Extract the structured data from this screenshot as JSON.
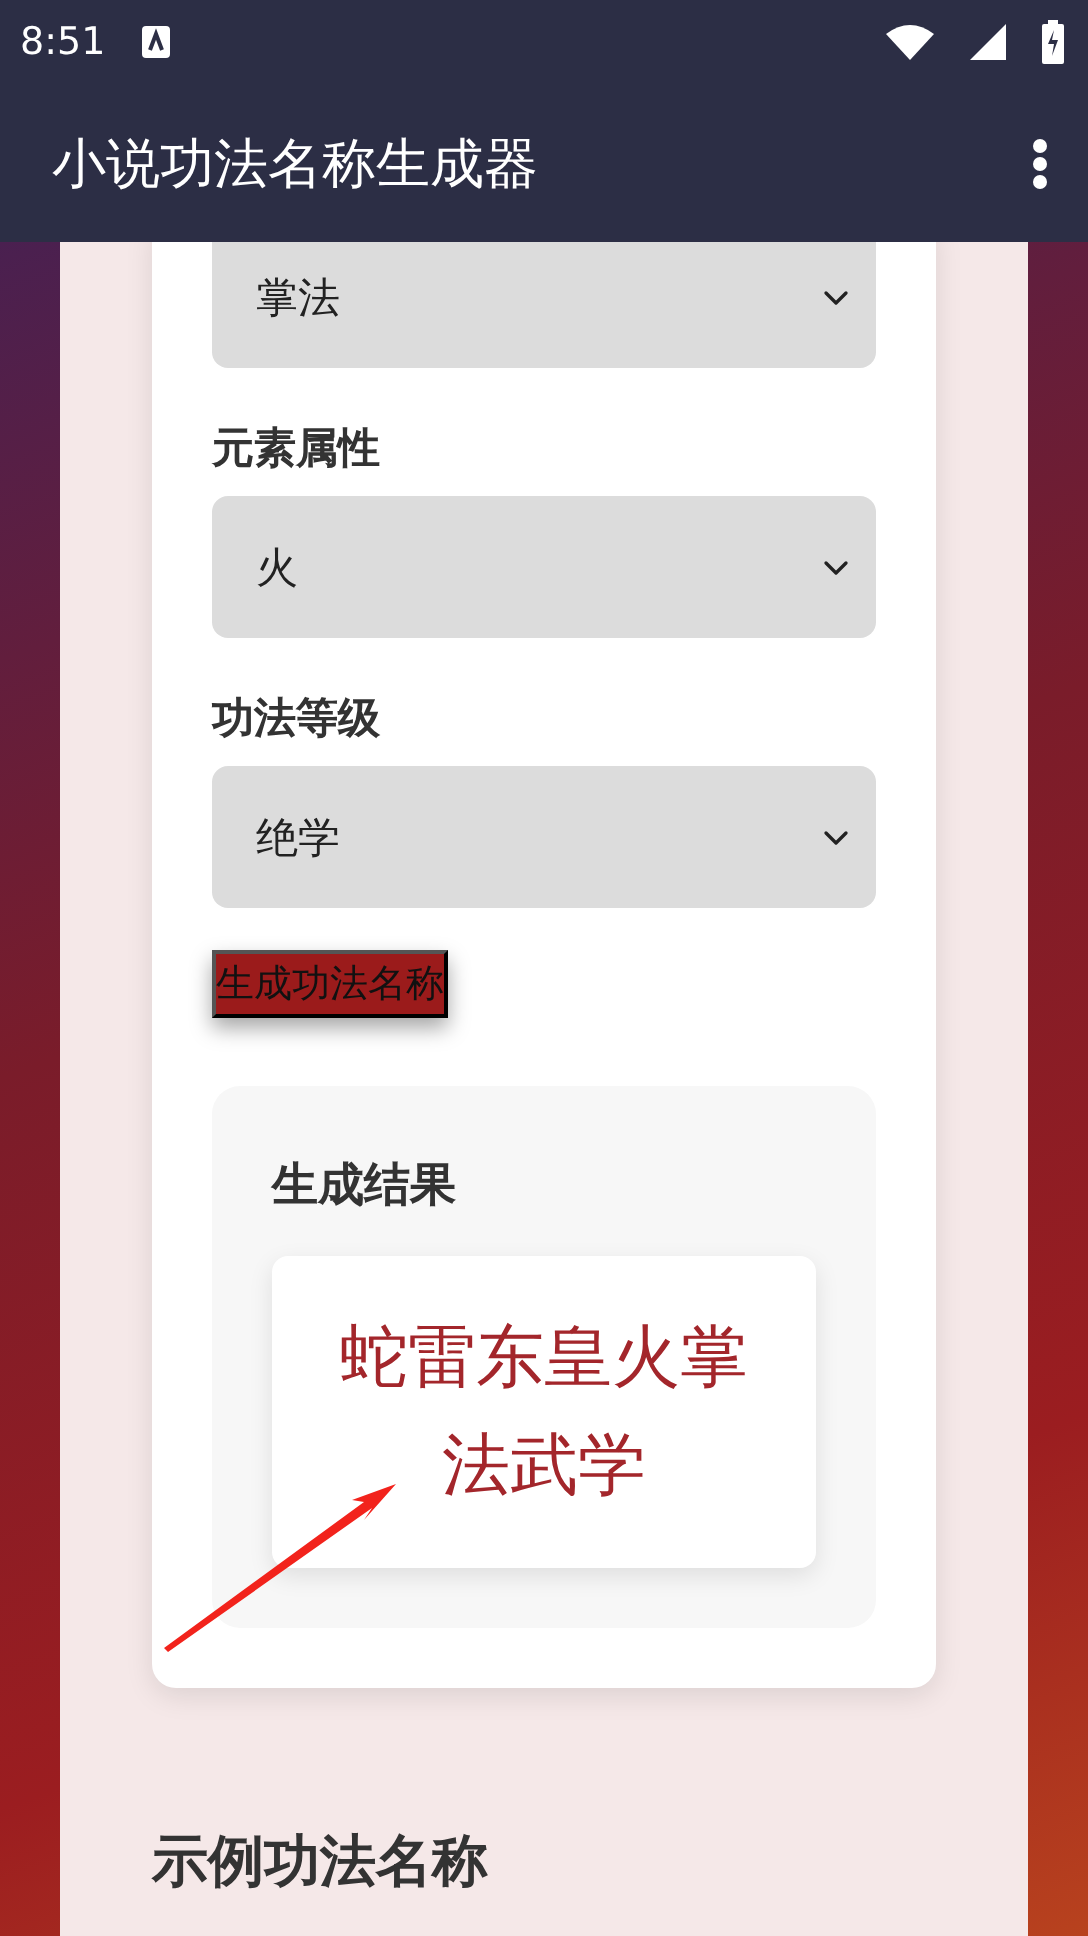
{
  "status_bar": {
    "time": "8:51"
  },
  "app_bar": {
    "title": "小说功法名称生成器"
  },
  "form": {
    "fields": [
      {
        "value": "掌法"
      },
      {
        "label": "元素属性",
        "value": "火"
      },
      {
        "label": "功法等级",
        "value": "绝学"
      }
    ],
    "generate_button": "生成功法名称"
  },
  "result": {
    "title": "生成结果",
    "name": "蛇雷东皇火掌法武学"
  },
  "examples": {
    "title": "示例功法名称"
  }
}
